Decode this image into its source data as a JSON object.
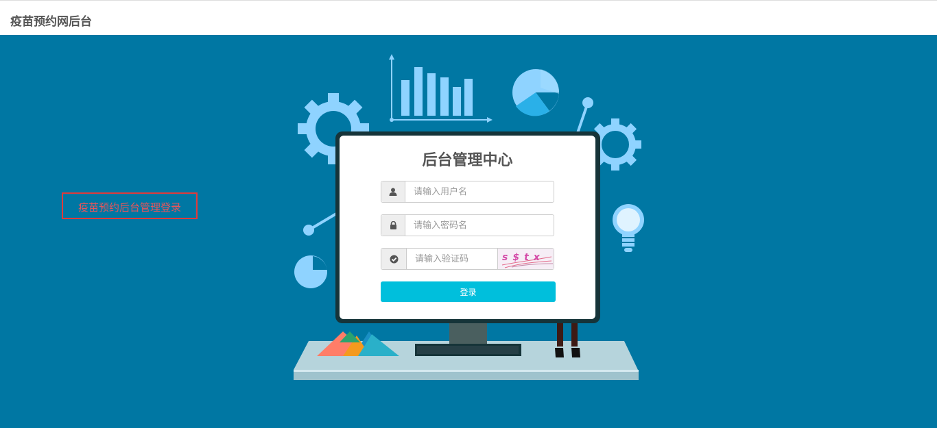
{
  "header": {
    "title": "疫苗预约网后台"
  },
  "hint": {
    "text": "疫苗预约后台管理登录"
  },
  "login": {
    "title": "后台管理中心",
    "username_placeholder": "请输入用户名",
    "password_placeholder": "请输入密码名",
    "captcha_placeholder": "请输入验证码",
    "captcha_text": "s$tx",
    "submit_label": "登录"
  },
  "icons": {
    "username": "user-icon",
    "password": "lock-icon",
    "captcha": "check-circle-icon"
  },
  "colors": {
    "background": "#0077a3",
    "button": "#00bfdc",
    "hint_border": "#e03a3a",
    "illustration": "#8fd3ff"
  }
}
